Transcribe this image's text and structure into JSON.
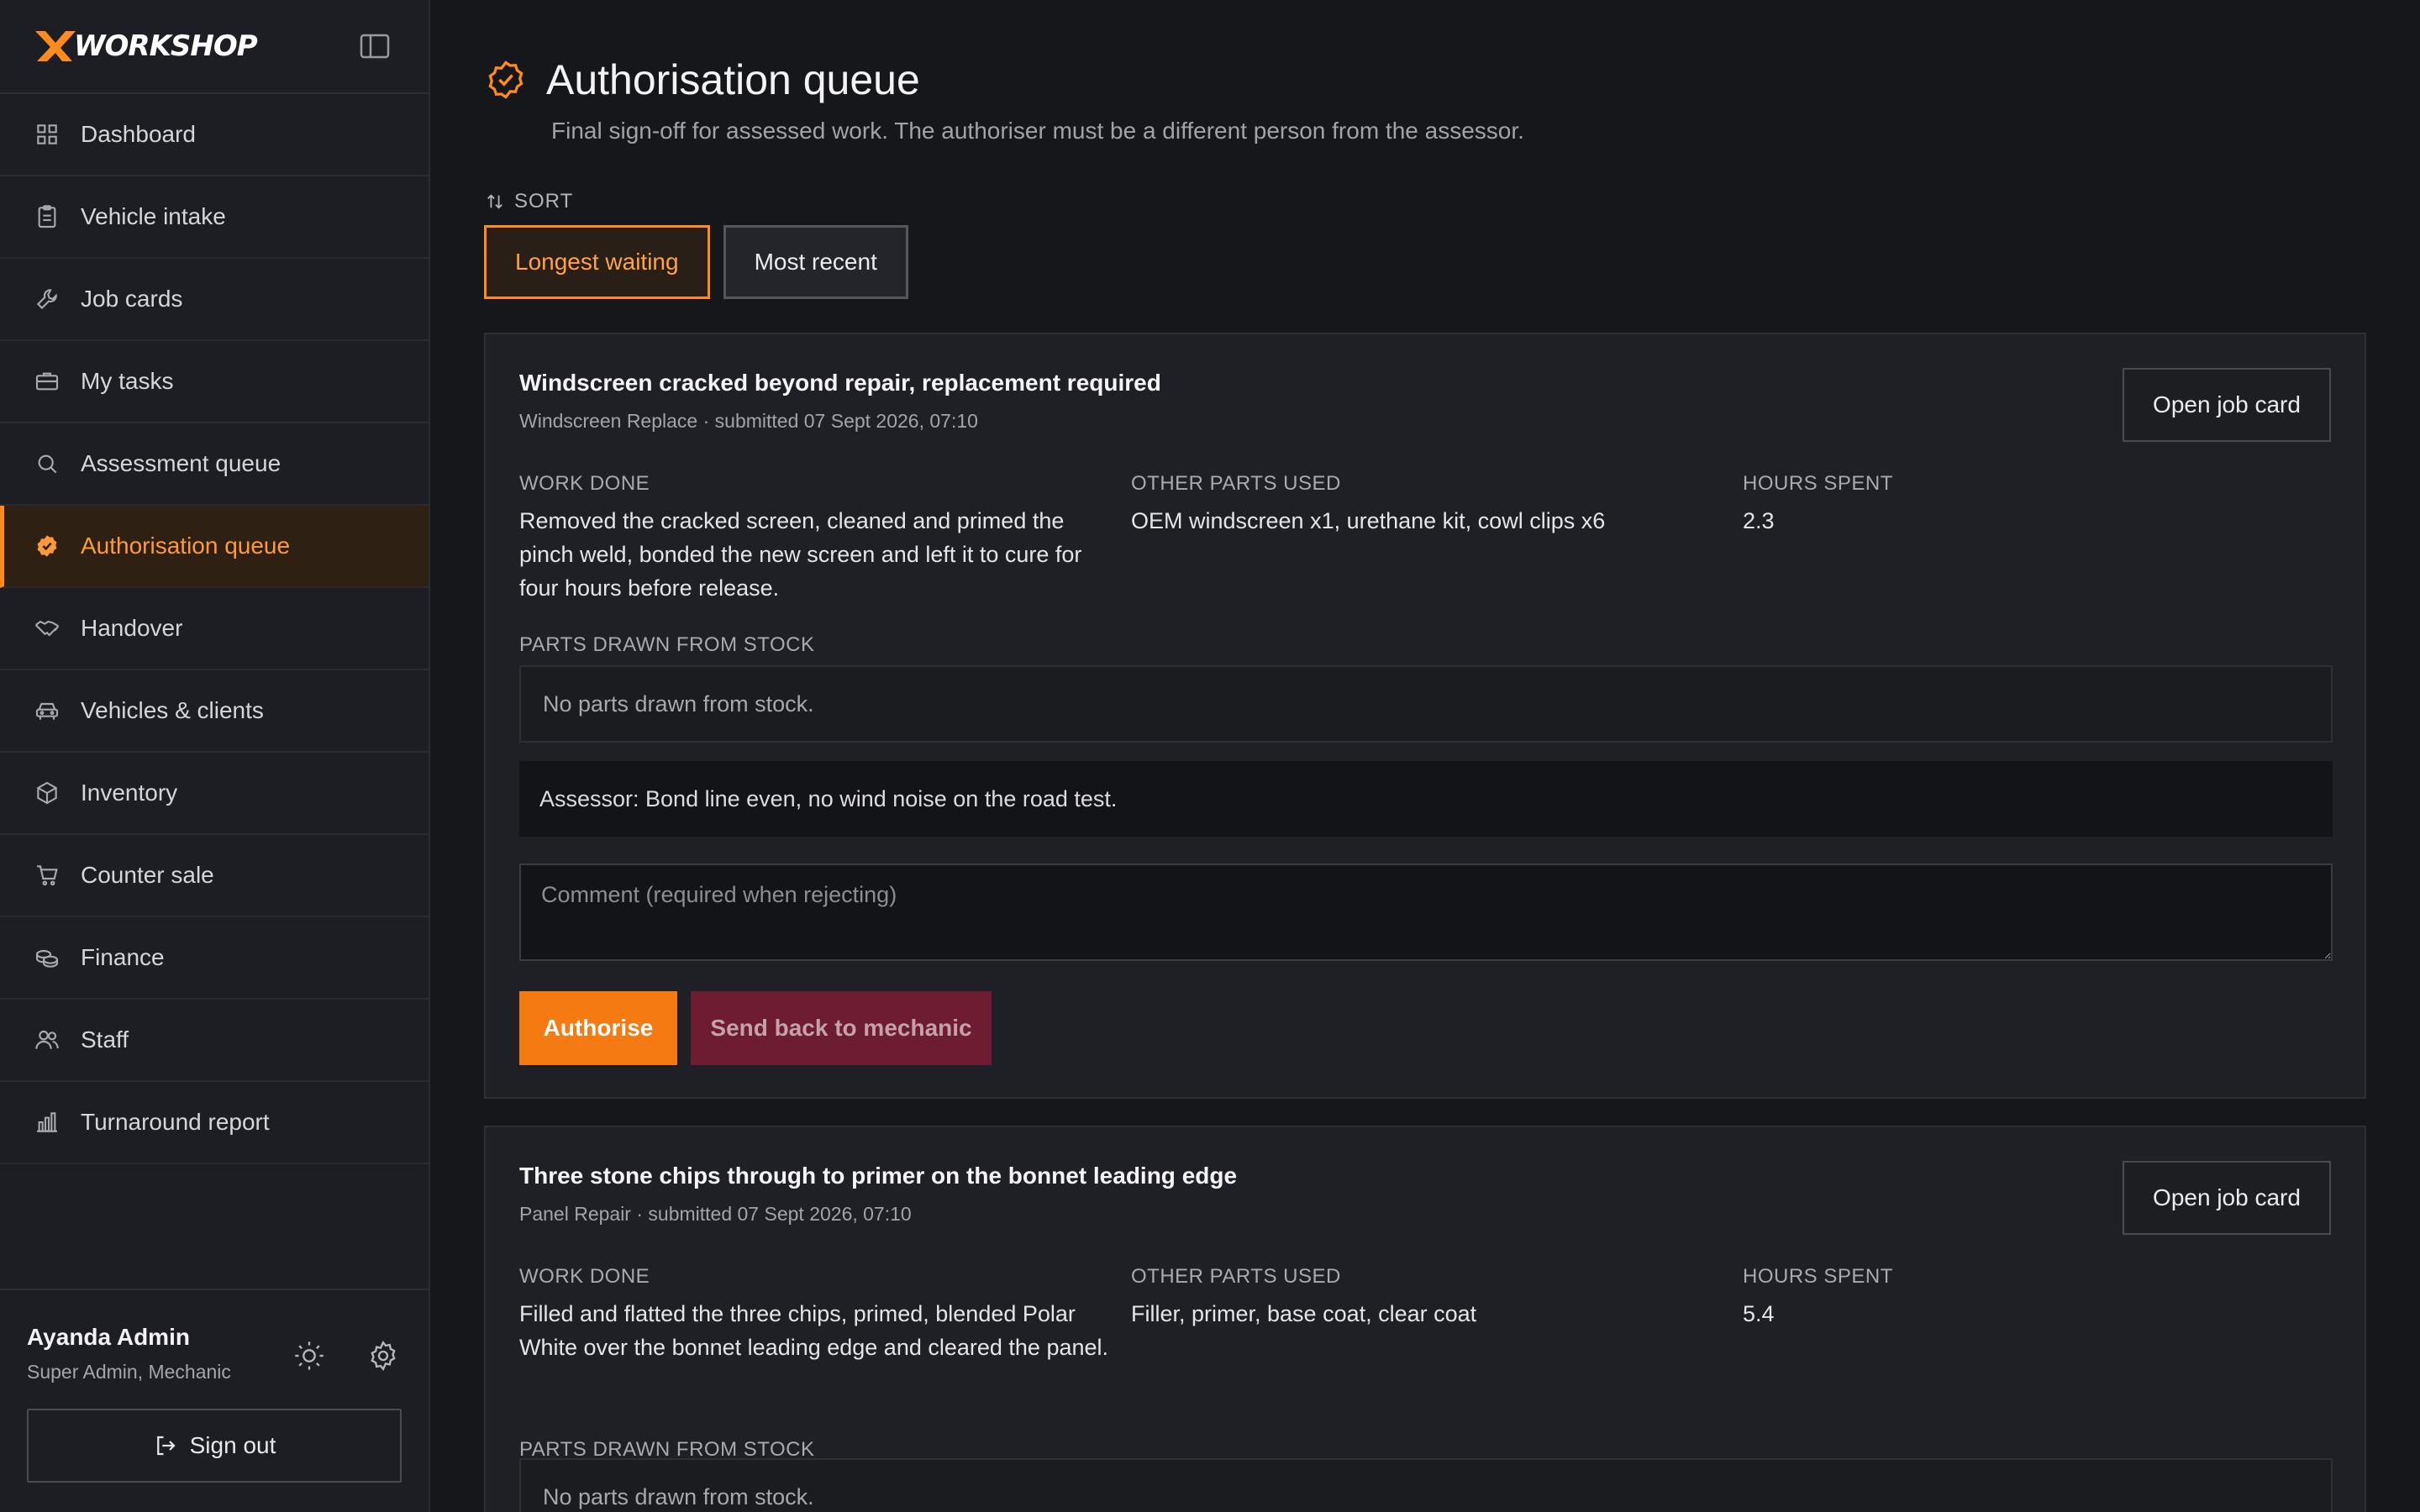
{
  "brand": {
    "name": "WORKSHOP",
    "accent": "#ff8a1e"
  },
  "sidebar": {
    "items": [
      {
        "label": "Dashboard",
        "icon": "grid-icon"
      },
      {
        "label": "Vehicle intake",
        "icon": "clipboard-icon"
      },
      {
        "label": "Job cards",
        "icon": "wrench-icon"
      },
      {
        "label": "My tasks",
        "icon": "briefcase-icon"
      },
      {
        "label": "Assessment queue",
        "icon": "search-icon"
      },
      {
        "label": "Authorisation queue",
        "icon": "badge-check-icon",
        "active": true
      },
      {
        "label": "Handover",
        "icon": "handshake-icon"
      },
      {
        "label": "Vehicles & clients",
        "icon": "car-icon"
      },
      {
        "label": "Inventory",
        "icon": "package-icon"
      },
      {
        "label": "Counter sale",
        "icon": "cart-icon"
      },
      {
        "label": "Finance",
        "icon": "coins-icon"
      },
      {
        "label": "Staff",
        "icon": "users-icon"
      },
      {
        "label": "Turnaround report",
        "icon": "bar-chart-icon"
      }
    ]
  },
  "user": {
    "name": "Ayanda Admin",
    "roles": "Super Admin, Mechanic",
    "signout_label": "Sign out"
  },
  "page": {
    "title": "Authorisation queue",
    "subtitle": "Final sign-off for assessed work. The authoriser must be a different person from the assessor.",
    "sort_label": "SORT",
    "sort_options": [
      "Longest waiting",
      "Most recent"
    ],
    "sort_selected": "Longest waiting"
  },
  "labels": {
    "open_job_card": "Open job card",
    "work_done": "WORK DONE",
    "other_parts_used": "OTHER PARTS USED",
    "hours_spent": "HOURS SPENT",
    "parts_drawn": "PARTS DRAWN FROM STOCK",
    "comment_placeholder": "Comment (required when rejecting)",
    "authorise": "Authorise",
    "send_back": "Send back to mechanic"
  },
  "cards": [
    {
      "title": "Windscreen cracked beyond repair, replacement required",
      "meta": "Windscreen Replace · submitted 07 Sept 2026, 07:10",
      "work_done": "Removed the cracked screen, cleaned and primed the pinch weld, bonded the new screen and left it to cure for four hours before release.",
      "other_parts": "OEM windscreen x1, urethane kit, cowl clips x6",
      "hours": "2.3",
      "stock": "No parts drawn from stock.",
      "assessor_note": "Assessor: Bond line even, no wind noise on the road test."
    },
    {
      "title": "Three stone chips through to primer on the bonnet leading edge",
      "meta": "Panel Repair · submitted 07 Sept 2026, 07:10",
      "work_done": "Filled and flatted the three chips, primed, blended Polar White over the bonnet leading edge and cleared the panel.",
      "other_parts": "Filler, primer, base coat, clear coat",
      "hours": "5.4",
      "stock": "No parts drawn from stock."
    }
  ]
}
